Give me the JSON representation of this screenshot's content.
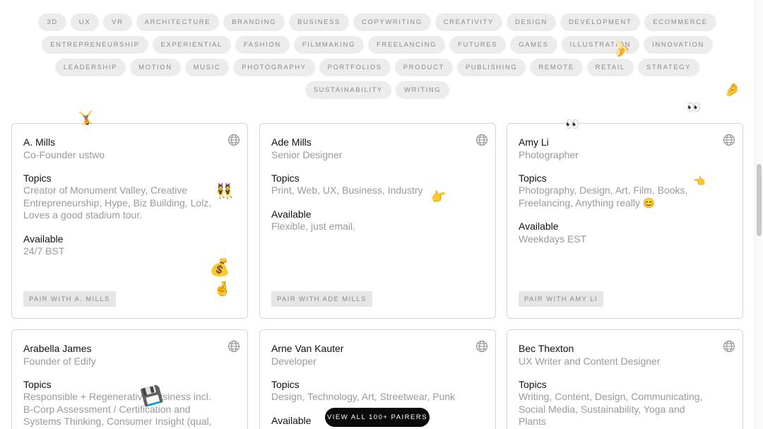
{
  "tags": [
    [
      "3D",
      "UX",
      "VR",
      "Architecture",
      "Branding",
      "Business",
      "Copywriting",
      "Creativity",
      "Design",
      "Development",
      "Ecommerce"
    ],
    [
      "Entrepreneurship",
      "Experiential",
      "Fashion",
      "Filmmaking",
      "Freelancing",
      "Futures",
      "Games",
      "Illustration",
      "Innovation"
    ],
    [
      "Leadership",
      "Motion",
      "Music",
      "Photography",
      "Portfolios",
      "Product",
      "Publishing",
      "Remote",
      "Retail",
      "Strategy"
    ],
    [
      "Sustainability",
      "Writing"
    ]
  ],
  "labels": {
    "topics": "Topics",
    "available": "Available"
  },
  "cards": [
    {
      "name": "A. Mills",
      "role": "Co-Founder ustwo",
      "topics": "Creator of Monument Valley, Creative Entrepreneurship, Hype, Biz Building, Lolz, Loves a good stadium tour.",
      "available": "24/7 BST",
      "button": "Pair with A. Mills"
    },
    {
      "name": "Ade Mills",
      "role": "Senior Designer",
      "topics": "Print, Web, UX, Business, Industry",
      "available": "Flexible, just email.",
      "button": "Pair with Ade Mills"
    },
    {
      "name": "Amy Li",
      "role": "Photographer",
      "topics": "Photography, Design, Art, Film, Books, Freelancing, Anything really 😊",
      "available": "Weekdays EST",
      "button": "Pair with Amy Li"
    },
    {
      "name": "Arabella James",
      "role": "Founder of Edify",
      "topics": "Responsible + Regenerative Business incl. B-Corp Assessment / Certification and Systems Thinking, Consumer Insight (qual, quant, ethno),",
      "available": "",
      "button": ""
    },
    {
      "name": "Arne Van Kauter",
      "role": "Developer",
      "topics": "Design, Technology, Art, Streetwear, Punk",
      "available": "",
      "button": ""
    },
    {
      "name": "Bec Thexton",
      "role": "UX Writer and Content Designer",
      "topics": "Writing, Content, Design, Communicating, Social Media, Sustainability, Yoga and Plants",
      "available": "",
      "button": ""
    }
  ],
  "view_all": "View all 100+ pairers",
  "icons": {
    "website": "globe-icon"
  },
  "emojis": [
    "🤸",
    "👯",
    "💰",
    "🤞",
    "👉",
    "👀",
    "👀",
    "🤌",
    "🍌",
    "👈",
    "💾"
  ]
}
